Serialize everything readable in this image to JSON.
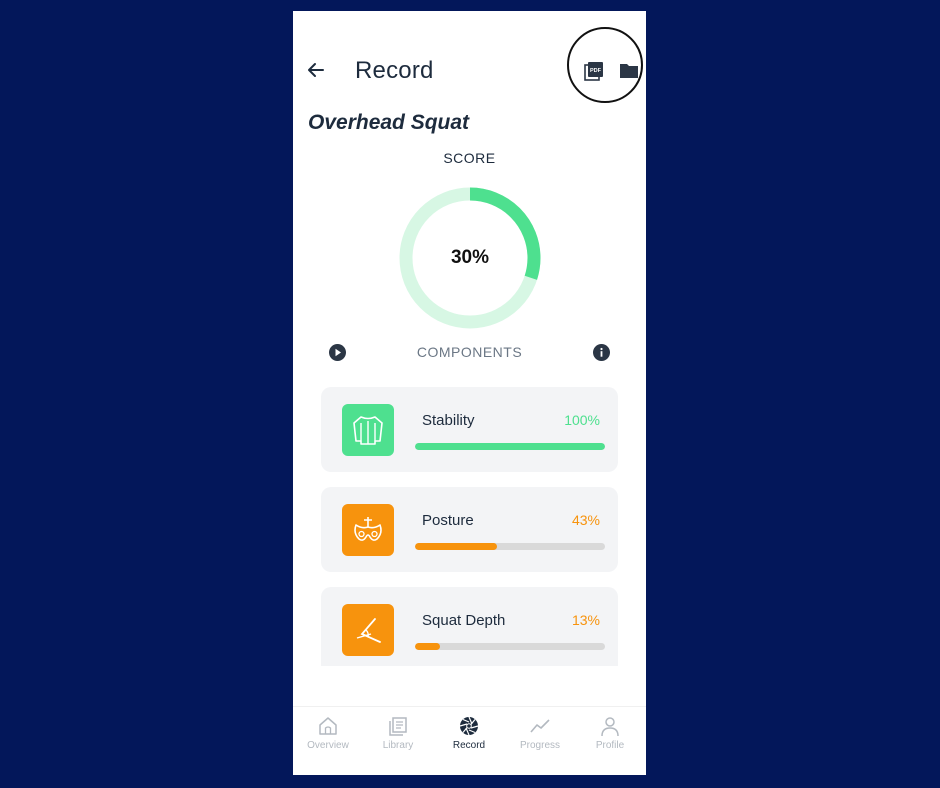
{
  "header": {
    "title": "Record",
    "back_icon": "arrow-left-icon",
    "pdf_icon": "pdf-export-icon",
    "folder_icon": "folder-icon",
    "pdf_badge_text": "PDF"
  },
  "exercise": {
    "name": "Overhead Squat"
  },
  "score": {
    "label": "SCORE",
    "value_text": "30%",
    "value": 0.3
  },
  "components_header": {
    "label": "COMPONENTS"
  },
  "components": [
    {
      "name": "Stability",
      "percent_text": "100%",
      "value": 1.0,
      "color": "#4ee08f",
      "icon": "torso-icon"
    },
    {
      "name": "Posture",
      "percent_text": "43%",
      "value": 0.43,
      "color": "#f7930d",
      "icon": "pelvis-icon"
    },
    {
      "name": "Squat Depth",
      "percent_text": "13%",
      "value": 0.13,
      "color": "#f7930d",
      "icon": "knee-angle-icon"
    }
  ],
  "nav": {
    "items": [
      {
        "label": "Overview",
        "icon": "home-icon",
        "active": false
      },
      {
        "label": "Library",
        "icon": "library-icon",
        "active": false
      },
      {
        "label": "Record",
        "icon": "camera-aperture-icon",
        "active": true
      },
      {
        "label": "Progress",
        "icon": "trend-icon",
        "active": false
      },
      {
        "label": "Profile",
        "icon": "person-icon",
        "active": false
      }
    ]
  },
  "colors": {
    "background": "#03175a",
    "accent_green": "#4ee08f",
    "accent_green_light": "#d7f7e4",
    "accent_orange": "#f7930d",
    "text_dark": "#1d2b3d"
  }
}
